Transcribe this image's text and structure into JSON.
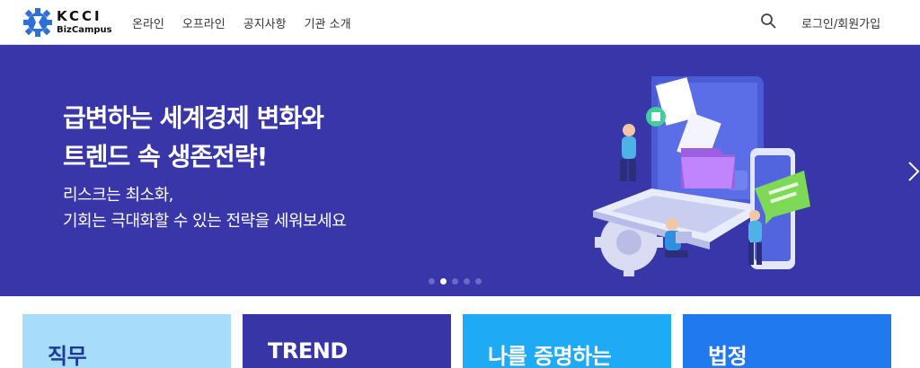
{
  "header": {
    "logo_line1": "KCCI",
    "logo_line2": "BizCampus",
    "nav": [
      {
        "label": "온라인"
      },
      {
        "label": "오프라인"
      },
      {
        "label": "공지사항"
      },
      {
        "label": "기관 소개"
      }
    ],
    "search_icon": "search-icon",
    "login_label": "로그인/회원가입"
  },
  "hero": {
    "title_line1": "급변하는 세계경제 변화와",
    "title_line2": "트렌드 속 생존전략!",
    "sub_line1": "리스크는 최소화,",
    "sub_line2": "기회는 극대화할 수 있는 전략을 세워보세요",
    "background_color": "#3836a8",
    "slide_count": 5,
    "active_slide": 2,
    "next_icon": "chevron-right-icon"
  },
  "cards": [
    {
      "label": "직무",
      "color": "#a8dcfb"
    },
    {
      "label": "TREND",
      "color": "#3835a7"
    },
    {
      "label": "나를 증명하는",
      "color": "#1eaaf5"
    },
    {
      "label": "법정",
      "color": "#2179ef"
    }
  ]
}
